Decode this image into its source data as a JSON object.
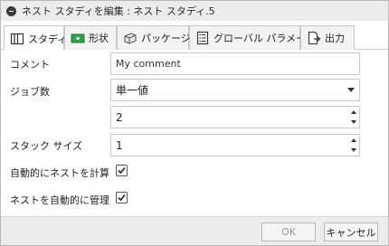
{
  "window": {
    "title": "ネスト スタディを編集 : ネスト スタディ.5"
  },
  "tabs": [
    {
      "label": "スタディ",
      "icon": "study-icon",
      "active": true
    },
    {
      "label": "形状",
      "icon": "shape-icon",
      "active": false
    },
    {
      "label": "パッケージ",
      "icon": "package-icon",
      "active": false
    },
    {
      "label": "グローバル パラメータ",
      "icon": "global-parameters-icon",
      "active": false
    },
    {
      "label": "出力",
      "icon": "output-icon",
      "active": false
    }
  ],
  "form": {
    "comment": {
      "label": "コメント",
      "value": "My comment"
    },
    "jobs": {
      "label": "ジョブ数",
      "selected": "単一値",
      "count": "2"
    },
    "stack_size": {
      "label": "スタック サイズ",
      "value": "1"
    },
    "auto_compute": {
      "label": "自動的にネストを計算",
      "checked": true
    },
    "auto_manage": {
      "label": "ネストを自動的に管理",
      "checked": true
    }
  },
  "footer": {
    "ok_label": "OK",
    "cancel_label": "キャンセル"
  },
  "colors": {
    "titlebar": "#ececec",
    "footer": "#ececec",
    "shape_icon_green": "#2e9e4f"
  }
}
